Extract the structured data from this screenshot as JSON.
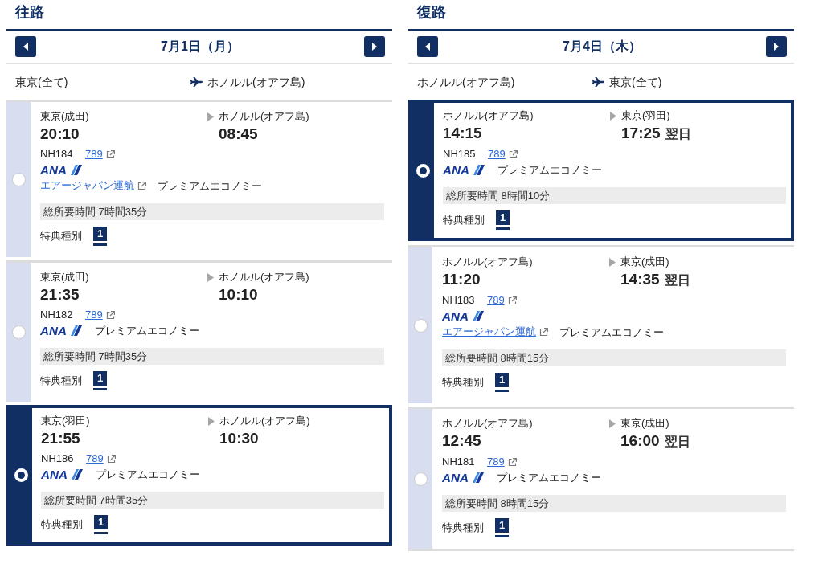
{
  "legs": [
    {
      "title": "往路",
      "date": "7月1日（月）",
      "origin": "東京(全て)",
      "destination": "ホノルル(オアフ島)",
      "flights": [
        {
          "selected": false,
          "departure_airport": "東京(成田)",
          "arrival_airport": "ホノルル(オアフ島)",
          "departure_time": "20:10",
          "arrival_time": "08:45",
          "flight_number": "NH184",
          "aircraft": "789",
          "airline": "ANA",
          "operator": "エアージャパン運航",
          "cabin": "プレミアムエコノミー",
          "duration": "総所要時間 7時間35分",
          "award_label": "特典種別",
          "award_type": "1"
        },
        {
          "selected": false,
          "departure_airport": "東京(成田)",
          "arrival_airport": "ホノルル(オアフ島)",
          "departure_time": "21:35",
          "arrival_time": "10:10",
          "flight_number": "NH182",
          "aircraft": "789",
          "airline": "ANA",
          "cabin": "プレミアムエコノミー",
          "duration": "総所要時間 7時間35分",
          "award_label": "特典種別",
          "award_type": "1"
        },
        {
          "selected": true,
          "departure_airport": "東京(羽田)",
          "arrival_airport": "ホノルル(オアフ島)",
          "departure_time": "21:55",
          "arrival_time": "10:30",
          "flight_number": "NH186",
          "aircraft": "789",
          "airline": "ANA",
          "cabin": "プレミアムエコノミー",
          "duration": "総所要時間 7時間35分",
          "award_label": "特典種別",
          "award_type": "1"
        }
      ]
    },
    {
      "title": "復路",
      "date": "7月4日（木）",
      "origin": "ホノルル(オアフ島)",
      "destination": "東京(全て)",
      "flights": [
        {
          "selected": true,
          "departure_airport": "ホノルル(オアフ島)",
          "arrival_airport": "東京(羽田)",
          "departure_time": "14:15",
          "arrival_time": "17:25",
          "arrival_note": "翌日",
          "flight_number": "NH185",
          "aircraft": "789",
          "airline": "ANA",
          "cabin": "プレミアムエコノミー",
          "duration": "総所要時間 8時間10分",
          "award_label": "特典種別",
          "award_type": "1"
        },
        {
          "selected": false,
          "departure_airport": "ホノルル(オアフ島)",
          "arrival_airport": "東京(成田)",
          "departure_time": "11:20",
          "arrival_time": "14:35",
          "arrival_note": "翌日",
          "flight_number": "NH183",
          "aircraft": "789",
          "airline": "ANA",
          "operator": "エアージャパン運航",
          "cabin": "プレミアムエコノミー",
          "duration": "総所要時間 8時間15分",
          "award_label": "特典種別",
          "award_type": "1"
        },
        {
          "selected": false,
          "departure_airport": "ホノルル(オアフ島)",
          "arrival_airport": "東京(成田)",
          "departure_time": "12:45",
          "arrival_time": "16:00",
          "arrival_note": "翌日",
          "flight_number": "NH181",
          "aircraft": "789",
          "airline": "ANA",
          "cabin": "プレミアムエコノミー",
          "duration": "総所要時間 8時間15分",
          "award_label": "特典種別",
          "award_type": "1"
        }
      ]
    }
  ]
}
